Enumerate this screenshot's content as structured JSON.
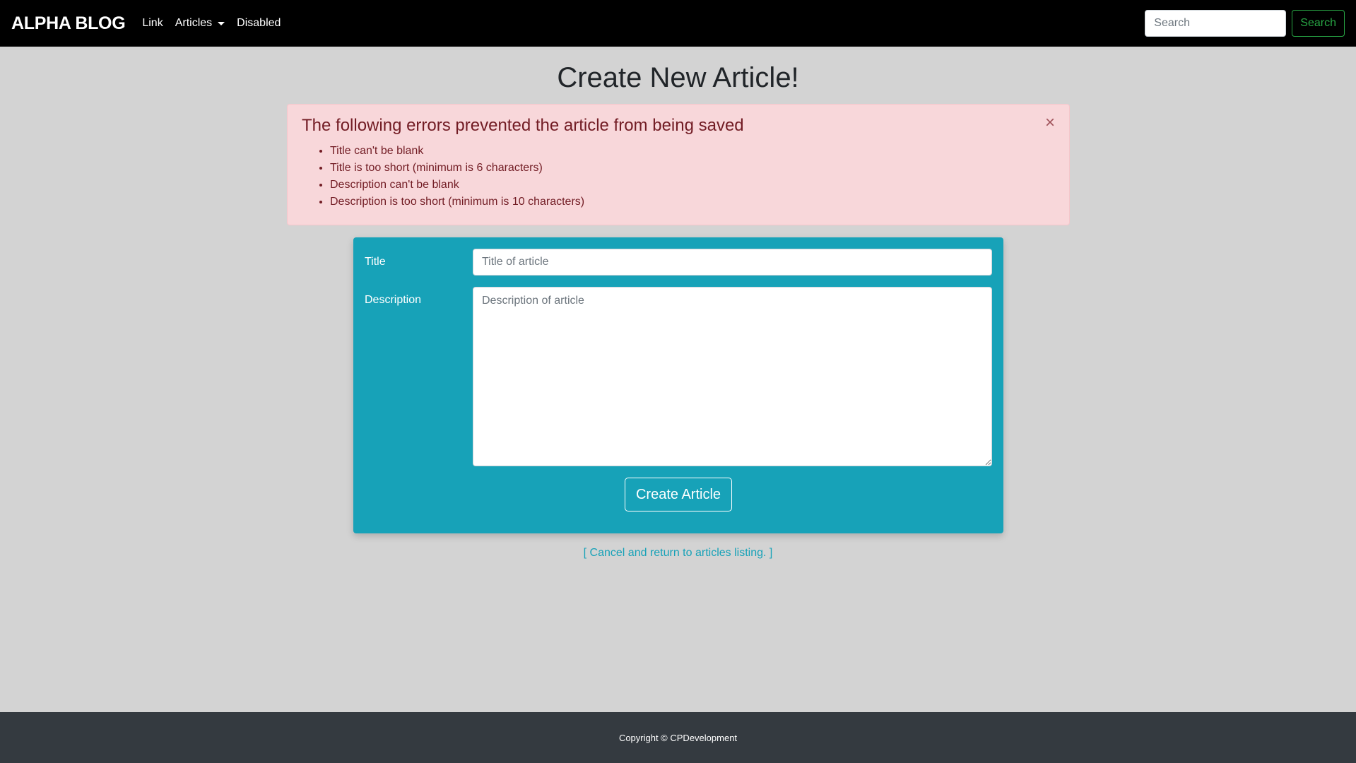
{
  "navbar": {
    "brand": "ALPHA BLOG",
    "links": [
      {
        "label": "Link"
      },
      {
        "label": "Articles"
      },
      {
        "label": "Disabled"
      }
    ],
    "search": {
      "placeholder": "Search",
      "button_label": "Search"
    }
  },
  "page": {
    "title": "Create New Article!"
  },
  "alert": {
    "heading": "The following errors prevented the article from being saved",
    "close_symbol": "×",
    "errors": [
      "Title can't be blank",
      "Title is too short (minimum is 6 characters)",
      "Description can't be blank",
      "Description is too short (minimum is 10 characters)"
    ]
  },
  "form": {
    "title_label": "Title",
    "title_placeholder": "Title of article",
    "description_label": "Description",
    "description_placeholder": "Description of article",
    "submit_label": "Create Article"
  },
  "cancel_link": "[ Cancel and return to articles listing. ]",
  "footer": {
    "text": "Copyright © CPDevelopment"
  },
  "colors": {
    "navbar_bg": "#000000",
    "page_bg": "#d3d3d3",
    "alert_bg": "#f8d7da",
    "alert_text": "#721c24",
    "form_bg": "#17a2b8",
    "search_button": "#28a745",
    "footer_bg": "#343a40"
  }
}
